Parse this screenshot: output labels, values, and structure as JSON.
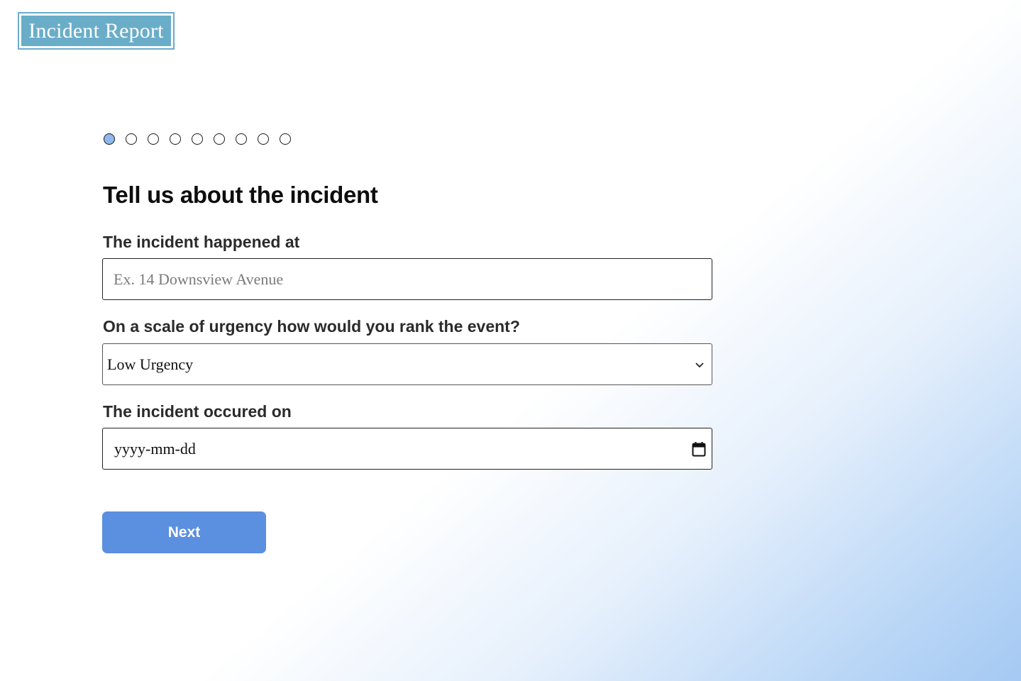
{
  "logo": {
    "text": "Incident Report"
  },
  "steps": {
    "total": 9,
    "current": 1
  },
  "form": {
    "heading": "Tell us about the incident",
    "address": {
      "label": "The incident happened at",
      "placeholder": "Ex. 14 Downsview Avenue",
      "value": ""
    },
    "urgency": {
      "label": "On a scale of urgency how would you rank the event?",
      "selected": "Low Urgency"
    },
    "date": {
      "label": "The incident occured on",
      "placeholder": "yyyy-mm-dd"
    },
    "next_label": "Next"
  },
  "icons": {
    "urgency_dropdown": "chevron-down-icon",
    "date_picker": "calendar-icon"
  },
  "colors": {
    "logo_bg": "#6aadc9",
    "active_step": "#8fb9ee",
    "button": "#5b8fdf",
    "gradient_accent": "#a5c9f3"
  }
}
